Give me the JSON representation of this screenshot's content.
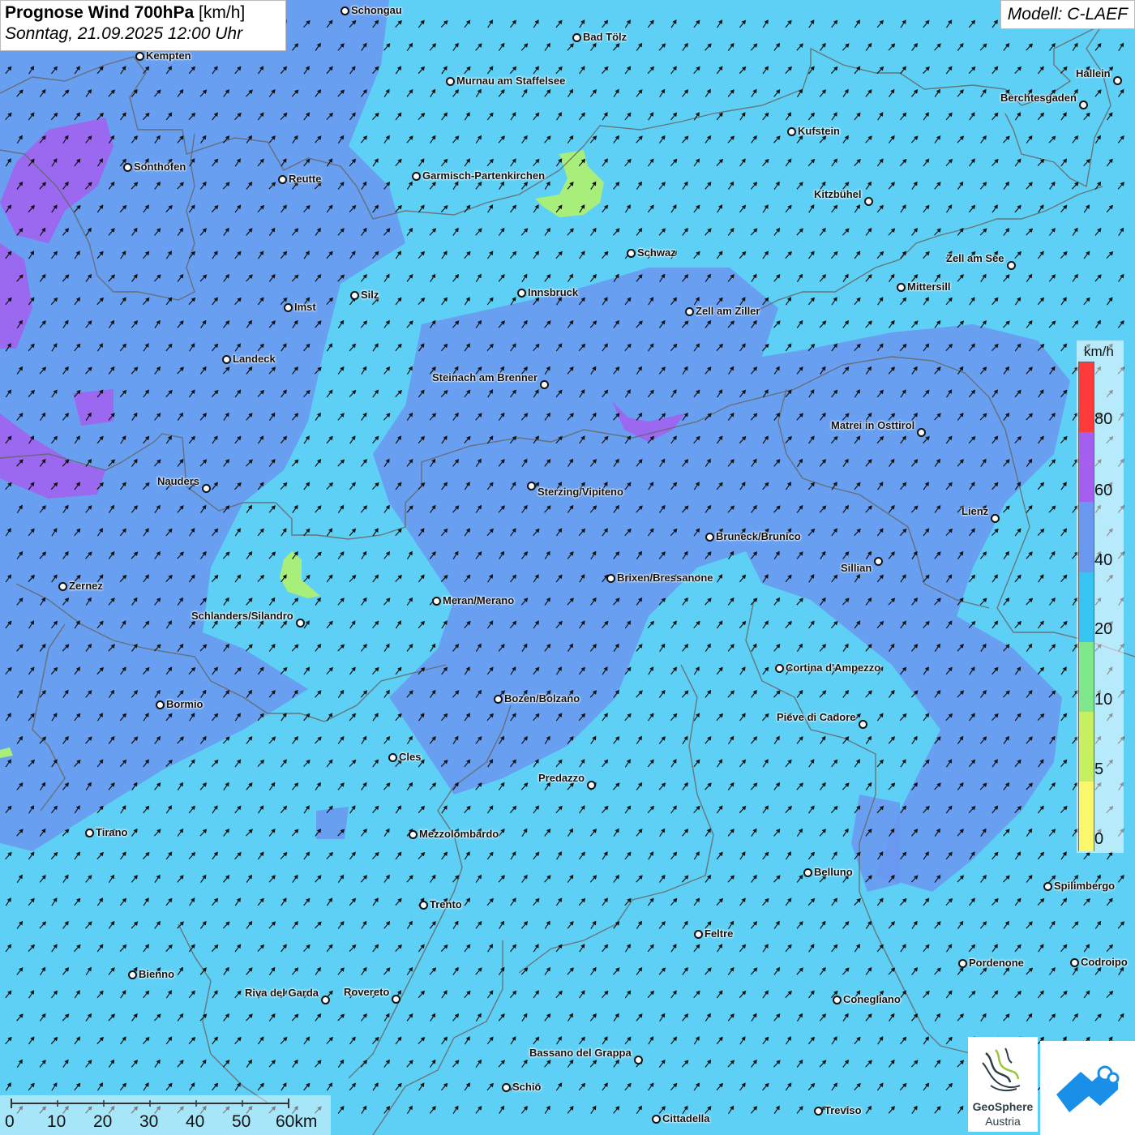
{
  "title": {
    "main": "Prognose Wind 700hPa",
    "unit": "[km/h]",
    "date": "Sonntag, 21.09.2025 12:00 Uhr"
  },
  "model": "Modell: C-LAEF",
  "legend": {
    "unit": "km/h",
    "labels": [
      "80",
      "60",
      "40",
      "20",
      "10",
      "5",
      "0"
    ],
    "colors": [
      "#ff3a3a",
      "#a45ef0",
      "#6a97f0",
      "#38c4f2",
      "#7fe88a",
      "#c6f060",
      "#fbf76c"
    ]
  },
  "scale": {
    "labels": [
      "0",
      "10",
      "20",
      "30",
      "40",
      "50",
      "60km"
    ]
  },
  "logo": {
    "name": "GeoSphere",
    "country": "Austria"
  },
  "colors": {
    "sea_light_blue": "#5fd0f5",
    "wind_40_60_blue": "#6a97f0",
    "wind_60_80_purple": "#a45ef0",
    "wind_10_20_green": "#a8ee7a",
    "border_gray": "#666666"
  },
  "icons": {
    "wind_arrow": "arrow-northeast-icon",
    "city_marker": "circle-dot-icon"
  },
  "cities": [
    {
      "name": "Schongau"
    },
    {
      "name": "Bad Tölz"
    },
    {
      "name": "Kempten"
    },
    {
      "name": "Murnau am Staffelsee"
    },
    {
      "name": "Hallein"
    },
    {
      "name": "Berchtesgaden"
    },
    {
      "name": "Kufstein"
    },
    {
      "name": "Sonthofen"
    },
    {
      "name": "Reutte"
    },
    {
      "name": "Garmisch-Partenkirchen"
    },
    {
      "name": "Kitzbühel"
    },
    {
      "name": "Schwaz"
    },
    {
      "name": "Zell am See"
    },
    {
      "name": "Mittersill"
    },
    {
      "name": "Innsbruck"
    },
    {
      "name": "Silz"
    },
    {
      "name": "Imst"
    },
    {
      "name": "Zell am Ziller"
    },
    {
      "name": "Landeck"
    },
    {
      "name": "Steinach am Brenner"
    },
    {
      "name": "Matrei in Osttirol"
    },
    {
      "name": "Nauders"
    },
    {
      "name": "Sterzing/Vipiteno"
    },
    {
      "name": "Lienz"
    },
    {
      "name": "Bruneck/Brunico"
    },
    {
      "name": "Sillian"
    },
    {
      "name": "Brixen/Bressanone"
    },
    {
      "name": "Zernez"
    },
    {
      "name": "Meran/Merano"
    },
    {
      "name": "Schlanders/Silandro"
    },
    {
      "name": "Cortina d'Ampezzo"
    },
    {
      "name": "Bozen/Bolzano"
    },
    {
      "name": "Bormio"
    },
    {
      "name": "Pieve di Cadore"
    },
    {
      "name": "Cles"
    },
    {
      "name": "Predazzo"
    },
    {
      "name": "Tirano"
    },
    {
      "name": "Mezzolombardo"
    },
    {
      "name": "Belluno"
    },
    {
      "name": "Spilimbergo"
    },
    {
      "name": "Trento"
    },
    {
      "name": "Feltre"
    },
    {
      "name": "Pordenone"
    },
    {
      "name": "Codroipo"
    },
    {
      "name": "Bienno"
    },
    {
      "name": "Riva del Garda"
    },
    {
      "name": "Rovereto"
    },
    {
      "name": "Conegliano"
    },
    {
      "name": "Bassano del Grappa"
    },
    {
      "name": "Schio"
    },
    {
      "name": "Treviso"
    },
    {
      "name": "Cittadella"
    }
  ]
}
